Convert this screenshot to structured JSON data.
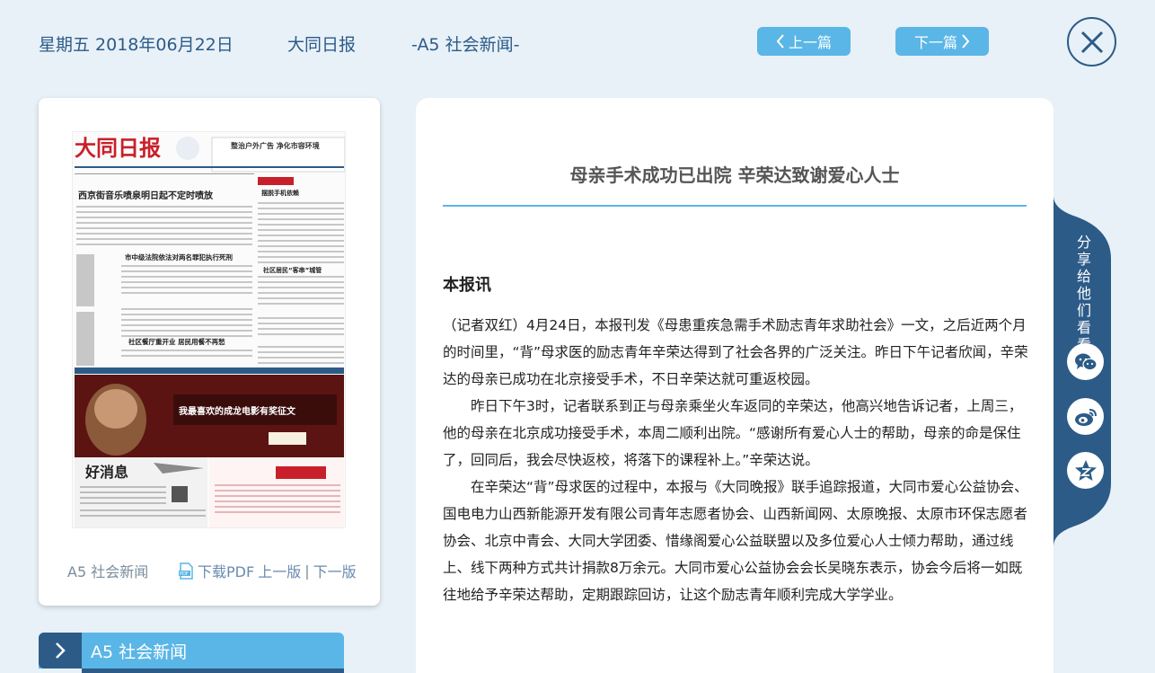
{
  "header": {
    "date": "星期五 2018年06月22日",
    "paper": "大同日报",
    "section": "-A5 社会新闻-",
    "prev_label": "上一篇",
    "next_label": "下一篇"
  },
  "thumbnail": {
    "masthead": "大同日报",
    "headlines": [
      "西京街音乐喷泉明日起不定时喷放",
      "整治户外广告 净化市容环境",
      "摆脱手机依赖",
      "市中级法院依法对两名罪犯执行死刑",
      "社区居民“客串”城管",
      "社区餐厅重开业 居民用餐不再愁",
      "我最喜欢的成龙电影有奖征文",
      "好消息"
    ],
    "section_label": "A5 社会新闻",
    "download_pdf": "下载PDF",
    "prev_page": "上一版",
    "separator": "|",
    "next_page": "下一版"
  },
  "section_tab": {
    "label": "A5  社会新闻"
  },
  "article": {
    "title": "母亲手术成功已出院 辛荣达致谢爱心人士",
    "heading": "本报讯",
    "paragraphs": [
      "（记者双红）4月24日，本报刊发《母患重疾急需手术励志青年求助社会》一文，之后近两个月的时间里，“背”母求医的励志青年辛荣达得到了社会各界的广泛关注。昨日下午记者欣闻，辛荣达的母亲已成功在北京接受手术，不日辛荣达就可重返校园。",
      "昨日下午3时，记者联系到正与母亲乘坐火车返同的辛荣达，他高兴地告诉记者，上周三，他的母亲在北京成功接受手术，本周二顺利出院。“感谢所有爱心人士的帮助，母亲的命是保住了，回同后，我会尽快返校，将落下的课程补上。”辛荣达说。",
      "在辛荣达“背”母求医的过程中，本报与《大同晚报》联手追踪报道，大同市爱心公益协会、国电电力山西新能源开发有限公司青年志愿者协会、山西新闻网、太原晚报、太原市环保志愿者协会、北京中青会、大同大学团委、惜缘阁爱心公益联盟以及多位爱心人士倾力帮助，通过线上、线下两种方式共计捐款8万余元。大同市爱心公益协会会长吴晓东表示，协会今后将一如既往地给予辛荣达帮助，定期跟踪回访，让这个励志青年顺利完成大学学业。"
    ]
  },
  "share": {
    "label": "分享给他们看看",
    "icons": [
      "wechat-icon",
      "weibo-icon",
      "qzone-icon"
    ]
  },
  "colors": {
    "background": "#e8f1f8",
    "primary": "#2c5b88",
    "accent": "#5ab6e6"
  }
}
